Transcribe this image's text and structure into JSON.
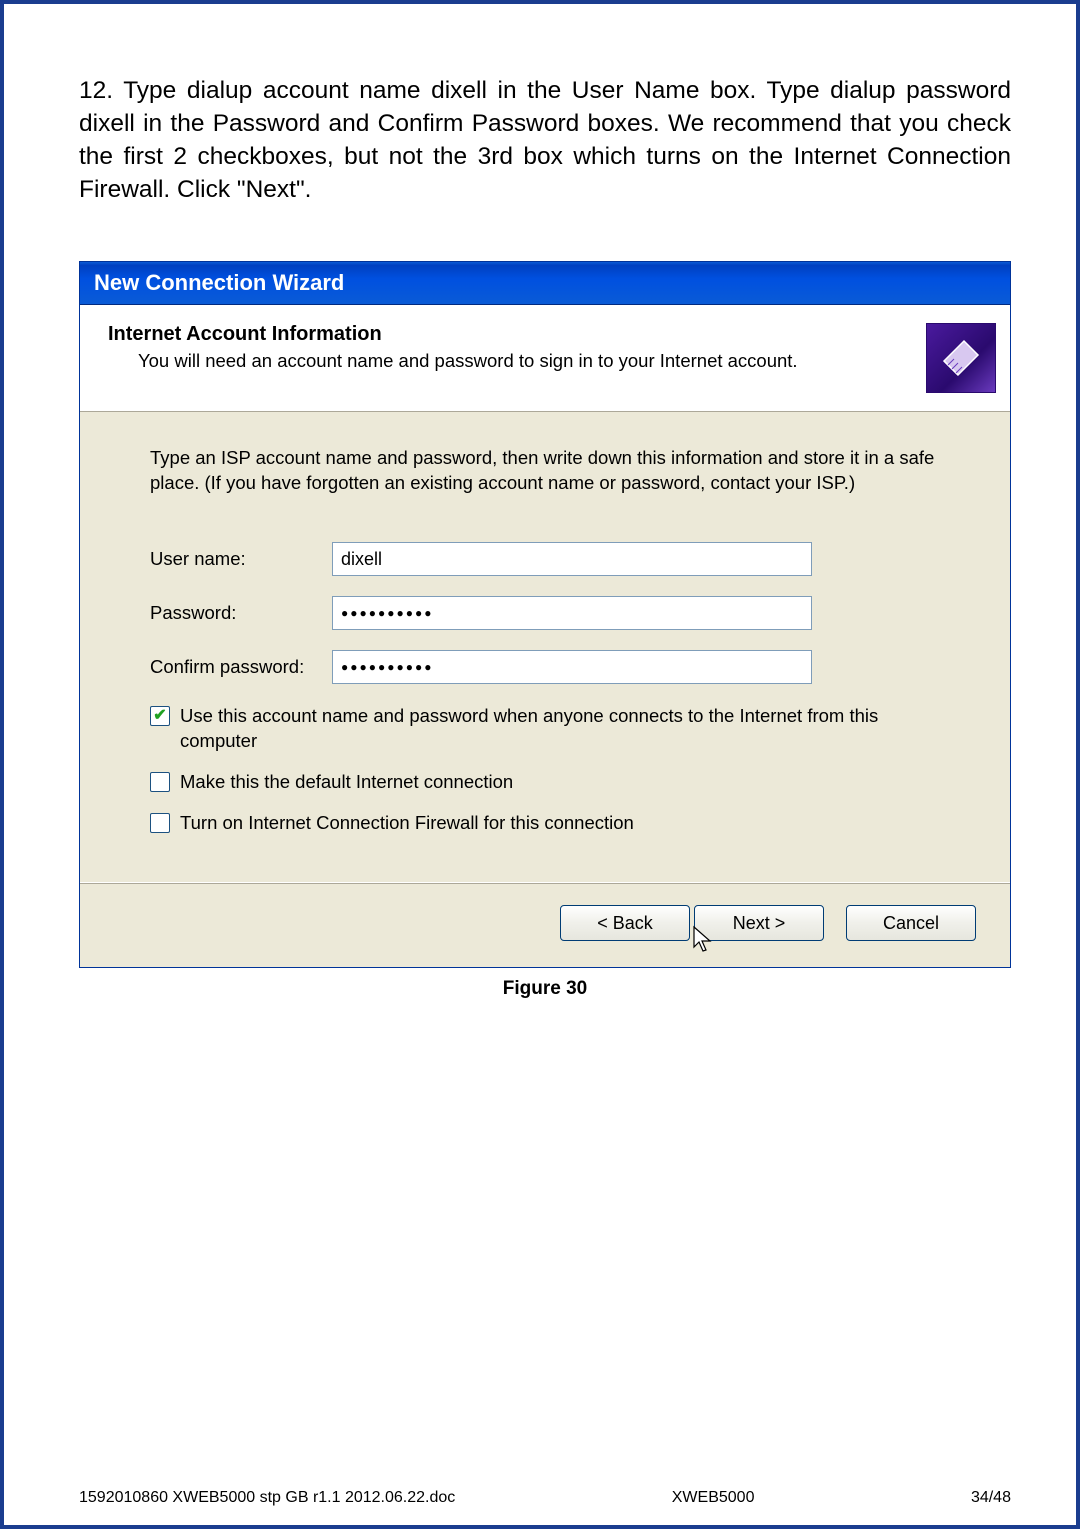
{
  "instruction": "12. Type dialup account name dixell in the User Name box. Type dialup password dixell in the Password and Confirm Password boxes. We recommend that you check the first 2 checkboxes, but not the 3rd box which turns on the Internet Connection Firewall. Click \"Next\".",
  "wizard": {
    "title": "New Connection Wizard",
    "header_title": "Internet Account Information",
    "header_sub": "You will need an account name and password to sign in to your Internet account.",
    "body_intro": "Type an ISP account name and password, then write down this information and store it in a safe place. (If you have forgotten an existing account name or password, contact your ISP.)",
    "labels": {
      "username": "User name:",
      "password": "Password:",
      "confirm": "Confirm password:"
    },
    "values": {
      "username": "dixell",
      "password": "●●●●●●●●●●",
      "confirm": "●●●●●●●●●●"
    },
    "checkboxes": {
      "c1": {
        "checked": true,
        "label": "Use this account  name and password when anyone connects to the Internet from this computer"
      },
      "c2": {
        "checked": false,
        "label": "Make this the default Internet connection"
      },
      "c3": {
        "checked": false,
        "label": "Turn on Internet Connection Firewall for this connection"
      }
    },
    "buttons": {
      "back": "< Back",
      "next": "Next >",
      "cancel": "Cancel"
    }
  },
  "figure_caption": "Figure 30",
  "footer": {
    "left": "1592010860 XWEB5000 stp GB r1.1 2012.06.22.doc",
    "center": "XWEB5000",
    "right": "34/48"
  }
}
